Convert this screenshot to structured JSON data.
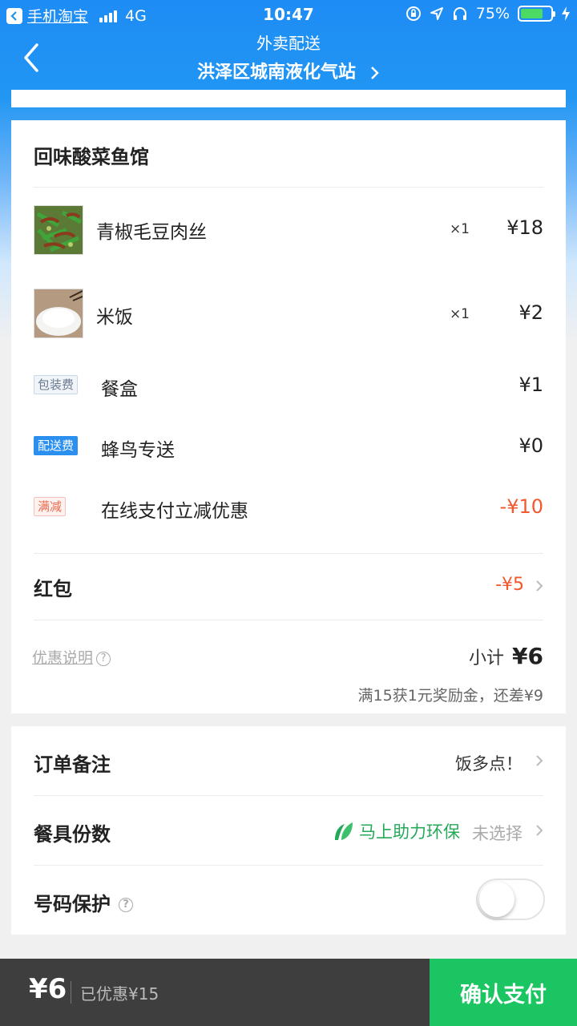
{
  "status_bar": {
    "app_name": "手机淘宝",
    "network": "4G",
    "time": "10:47",
    "battery": "75%",
    "battery_level": 0.75
  },
  "nav": {
    "subtitle": "外卖配送",
    "title": "洪泽区城南液化气站"
  },
  "shop": {
    "name": "回味酸菜鱼馆"
  },
  "items": [
    {
      "name": "青椒毛豆肉丝",
      "qty": "×1",
      "price": "¥18"
    },
    {
      "name": "米饭",
      "qty": "×1",
      "price": "¥2"
    }
  ],
  "fees": [
    {
      "tag": "包装费",
      "name": "餐盒",
      "price": "¥1"
    },
    {
      "tag": "配送费",
      "name": "蜂鸟专送",
      "price": "¥0"
    },
    {
      "tag": "满减",
      "name": "在线支付立减优惠",
      "price": "-¥10"
    }
  ],
  "red_packet": {
    "label": "红包",
    "value": "-¥5"
  },
  "summary": {
    "promo_link": "优惠说明",
    "help": "?",
    "subtotal_label": "小计",
    "subtotal_value": "¥6",
    "bonus_note": "满15获1元奖励金，还差¥9"
  },
  "extras": {
    "remark_label": "订单备注",
    "remark_value": "饭多点！",
    "utensils_label": "餐具份数",
    "eco_text": "马上助力环保",
    "utensils_value": "未选择",
    "privacy_label": "号码保护",
    "privacy_help": "?",
    "privacy_enabled": false
  },
  "bottom": {
    "total": "¥6",
    "saved": "已优惠¥15",
    "pay_label": "确认支付"
  },
  "colors": {
    "brand_blue": "#2196f3",
    "discount_red": "#f2572d",
    "pay_green": "#1bc562",
    "eco_green": "#26a85a"
  }
}
